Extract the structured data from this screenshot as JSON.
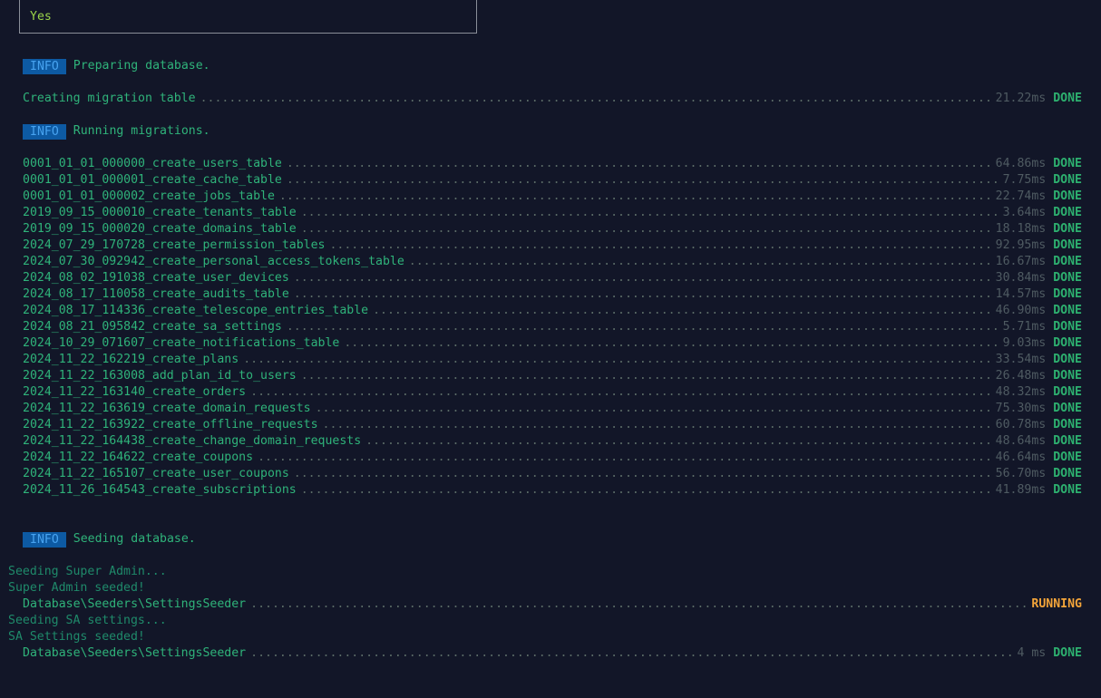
{
  "prompt_box": {
    "answer": "Yes"
  },
  "info_badge": "INFO",
  "messages": {
    "preparing": "Preparing database.",
    "running": "Running migrations.",
    "seeding": "Seeding database."
  },
  "migration_table": {
    "name": "Creating migration table",
    "time": "21.22ms",
    "status": "DONE"
  },
  "migrations": [
    {
      "name": "0001_01_01_000000_create_users_table",
      "time": "64.86ms",
      "status": "DONE"
    },
    {
      "name": "0001_01_01_000001_create_cache_table",
      "time": "7.75ms",
      "status": "DONE"
    },
    {
      "name": "0001_01_01_000002_create_jobs_table",
      "time": "22.74ms",
      "status": "DONE"
    },
    {
      "name": "2019_09_15_000010_create_tenants_table",
      "time": "3.64ms",
      "status": "DONE"
    },
    {
      "name": "2019_09_15_000020_create_domains_table",
      "time": "18.18ms",
      "status": "DONE"
    },
    {
      "name": "2024_07_29_170728_create_permission_tables",
      "time": "92.95ms",
      "status": "DONE"
    },
    {
      "name": "2024_07_30_092942_create_personal_access_tokens_table",
      "time": "16.67ms",
      "status": "DONE"
    },
    {
      "name": "2024_08_02_191038_create_user_devices",
      "time": "30.84ms",
      "status": "DONE"
    },
    {
      "name": "2024_08_17_110058_create_audits_table",
      "time": "14.57ms",
      "status": "DONE"
    },
    {
      "name": "2024_08_17_114336_create_telescope_entries_table",
      "time": "46.90ms",
      "status": "DONE"
    },
    {
      "name": "2024_08_21_095842_create_sa_settings",
      "time": "5.71ms",
      "status": "DONE"
    },
    {
      "name": "2024_10_29_071607_create_notifications_table",
      "time": "9.03ms",
      "status": "DONE"
    },
    {
      "name": "2024_11_22_162219_create_plans",
      "time": "33.54ms",
      "status": "DONE"
    },
    {
      "name": "2024_11_22_163008_add_plan_id_to_users",
      "time": "26.48ms",
      "status": "DONE"
    },
    {
      "name": "2024_11_22_163140_create_orders",
      "time": "48.32ms",
      "status": "DONE"
    },
    {
      "name": "2024_11_22_163619_create_domain_requests",
      "time": "75.30ms",
      "status": "DONE"
    },
    {
      "name": "2024_11_22_163922_create_offline_requests",
      "time": "60.78ms",
      "status": "DONE"
    },
    {
      "name": "2024_11_22_164438_create_change_domain_requests",
      "time": "48.64ms",
      "status": "DONE"
    },
    {
      "name": "2024_11_22_164622_create_coupons",
      "time": "46.64ms",
      "status": "DONE"
    },
    {
      "name": "2024_11_22_165107_create_user_coupons",
      "time": "56.70ms",
      "status": "DONE"
    },
    {
      "name": "2024_11_26_164543_create_subscriptions",
      "time": "41.89ms",
      "status": "DONE"
    }
  ],
  "seeding": {
    "line1": "Seeding Super Admin...",
    "line2": "Super Admin seeded!",
    "seeder1": {
      "name": "Database\\Seeders\\SettingsSeeder",
      "time": "",
      "status": "RUNNING"
    },
    "line3": "Seeding SA settings...",
    "line4": "SA Settings seeded!",
    "seeder2": {
      "name": "Database\\Seeders\\SettingsSeeder",
      "time": "4 ms",
      "status": "DONE"
    }
  }
}
